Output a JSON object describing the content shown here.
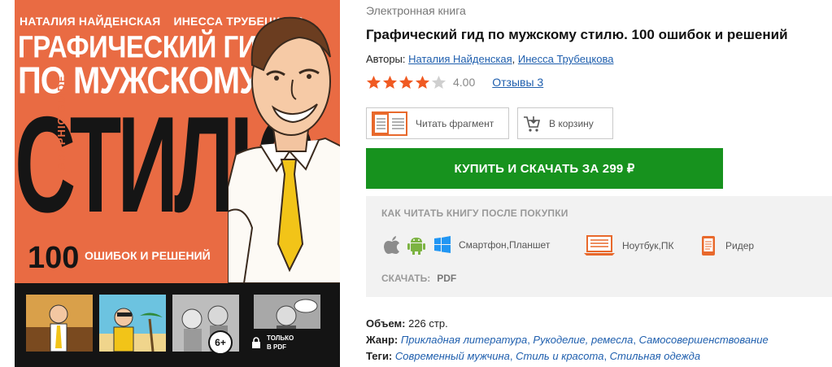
{
  "cover": {
    "authors": [
      "НАТАЛИЯ НАЙДЕНСКАЯ",
      "ИНЕССА ТРУБЕЦКОВА"
    ],
    "title_line1": "ГРАФИЧЕСКИЙ ГИД",
    "title_line2": "ПО МУЖСКОМУ",
    "title_big": "СТИЛЮ",
    "vertical_text": "GRAPHIC GUIDE",
    "number": "100",
    "subtitle": "ОШИБОК И РЕШЕНИЙ",
    "age_badge": "6+",
    "pdf_notice": [
      "ТОЛЬКО",
      "В PDF"
    ],
    "colors": {
      "background": "#e96b43",
      "strip": "#141414"
    }
  },
  "book": {
    "type": "Электронная книга",
    "title": "Графический гид по мужскому стилю. 100 ошибок и решений",
    "authors_label": "Авторы:",
    "authors": [
      "Наталия Найденская",
      "Инесса Трубецкова"
    ],
    "rating": {
      "stars_filled": 4,
      "stars_total": 5,
      "value": "4.00"
    },
    "reviews_label": "Отзывы 3"
  },
  "buttons": {
    "read_fragment": "Читать фрагмент",
    "add_to_cart": "В корзину",
    "buy": "КУПИТЬ И СКАЧАТЬ ЗА 299 ₽"
  },
  "how_to_read": {
    "title": "КАК ЧИТАТЬ КНИГУ ПОСЛЕ ПОКУПКИ",
    "devices": [
      {
        "label": "Смартфон,Планшет",
        "icons": [
          "apple-icon",
          "android-icon",
          "windows-icon"
        ]
      },
      {
        "label": "Ноутбук,ПК",
        "icons": [
          "laptop-icon"
        ]
      },
      {
        "label": "Ридер",
        "icons": [
          "ereader-icon"
        ]
      }
    ],
    "download_label": "СКАЧАТЬ:",
    "download_format": "PDF"
  },
  "specs": {
    "volume_label": "Объем:",
    "volume_value": "226 стр.",
    "genre_label": "Жанр:",
    "genres": [
      "Прикладная литература",
      "Рукоделие, ремесла",
      "Самосовершенствование"
    ],
    "tags_label": "Теги:",
    "tags": [
      "Современный мужчина",
      "Стиль и красота",
      "Стильная одежда"
    ]
  },
  "colors": {
    "accent_green": "#17921e",
    "link": "#1f5fae",
    "star": "#f05a22",
    "icon_orange": "#e8692c"
  }
}
